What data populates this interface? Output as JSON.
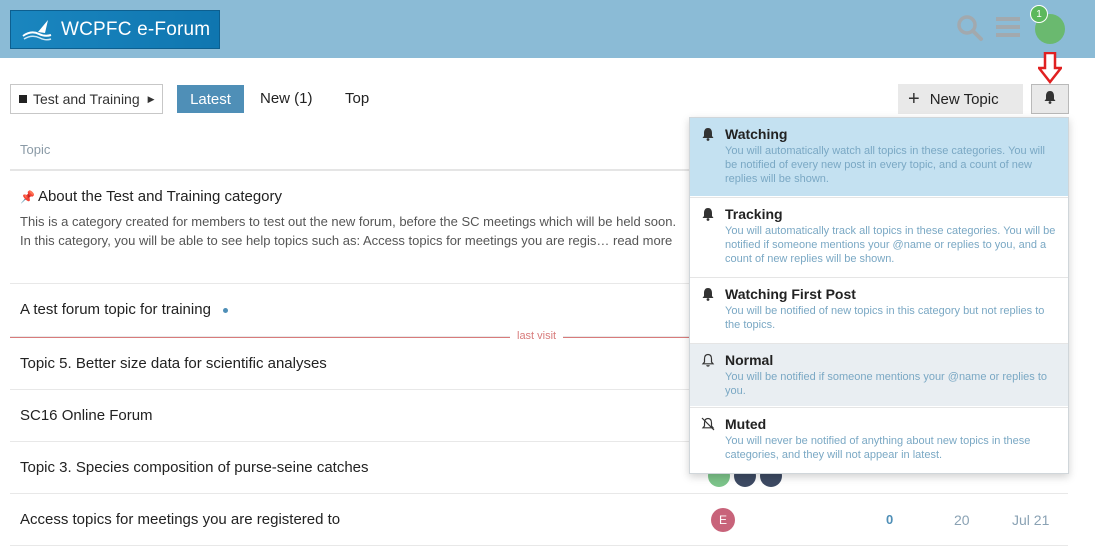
{
  "header": {
    "site_title": "WCPFC e-Forum",
    "notification_count": "1",
    "brand_color": "#8bbbd6",
    "icons": [
      "search-icon",
      "hamburger-menu-icon",
      "user-avatar"
    ]
  },
  "navigation": {
    "category_label": "Test and Training",
    "tabs": [
      {
        "label": "Latest",
        "active": true
      },
      {
        "label": "New (1)",
        "active": false
      },
      {
        "label": "Top",
        "active": false
      }
    ],
    "new_topic_label": "New Topic"
  },
  "topic_list": {
    "column_topic": "Topic",
    "last_visit_label": "last visit",
    "rows": [
      {
        "title": "About the Test and Training category",
        "pinned": true,
        "excerpt": "This is a category created for members to test out the new forum, before the SC meetings which will be held soon. In this category, you will be able to see help topics such as: Access topics for meetings you are regis… read more"
      },
      {
        "title": "A test forum topic for training",
        "unread": true
      },
      {
        "title": "Topic 5. Better size data for scientific analyses"
      },
      {
        "title": "SC16 Online Forum"
      },
      {
        "title": "Topic 3. Species composition of purse-seine catches"
      },
      {
        "title": "Access topics for meetings you are registered to",
        "poster_initial": "E",
        "replies": "0",
        "views": "20",
        "activity": "Jul 21"
      }
    ]
  },
  "notification_menu": {
    "options": [
      {
        "title": "Watching",
        "description": "You will automatically watch all topics in these categories. You will be notified of every new post in every topic, and a count of new replies will be shown.",
        "icon": "bell-filled-icon",
        "selected": true
      },
      {
        "title": "Tracking",
        "description": "You will automatically track all topics in these categories. You will be notified if someone mentions your @name or replies to you, and a count of new replies will be shown.",
        "icon": "bell-filled-icon"
      },
      {
        "title": "Watching First Post",
        "description": "You will be notified of new topics in this category but not replies to the topics.",
        "icon": "bell-filled-icon"
      },
      {
        "title": "Normal",
        "description": "You will be notified if someone mentions your @name or replies to you.",
        "icon": "bell-outline-icon",
        "hovered": true
      },
      {
        "title": "Muted",
        "description": "You will never be notified of anything about new topics in these categories, and they will not appear in latest.",
        "icon": "bell-slash-icon"
      }
    ]
  }
}
